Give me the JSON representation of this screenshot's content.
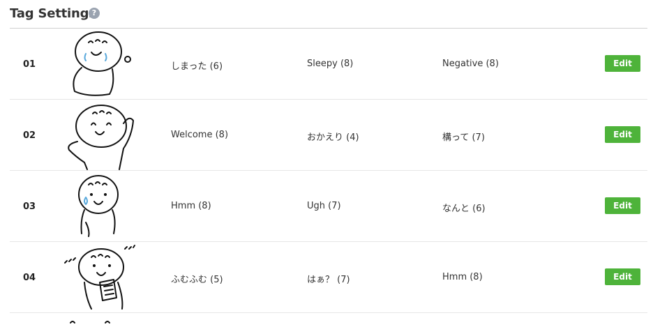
{
  "page": {
    "title": "Tag Settings",
    "help_glyph": "?"
  },
  "rows": [
    {
      "number": "01",
      "tags": [
        "しまった (6)",
        "Sleepy (8)",
        "Negative (8)"
      ],
      "edit_label": "Edit"
    },
    {
      "number": "02",
      "tags": [
        "Welcome (8)",
        "おかえり (4)",
        "構って (7)"
      ],
      "edit_label": "Edit"
    },
    {
      "number": "03",
      "tags": [
        "Hmm (8)",
        "Ugh (7)",
        "なんと (6)"
      ],
      "edit_label": "Edit"
    },
    {
      "number": "04",
      "tags": [
        "ふむふむ (5)",
        "はぁ？ (7)",
        "Hmm (8)"
      ],
      "edit_label": "Edit"
    }
  ],
  "colors": {
    "edit_button": "#4eb33a",
    "divider": "#e6e6e6",
    "help_icon": "#9aa3b0"
  }
}
